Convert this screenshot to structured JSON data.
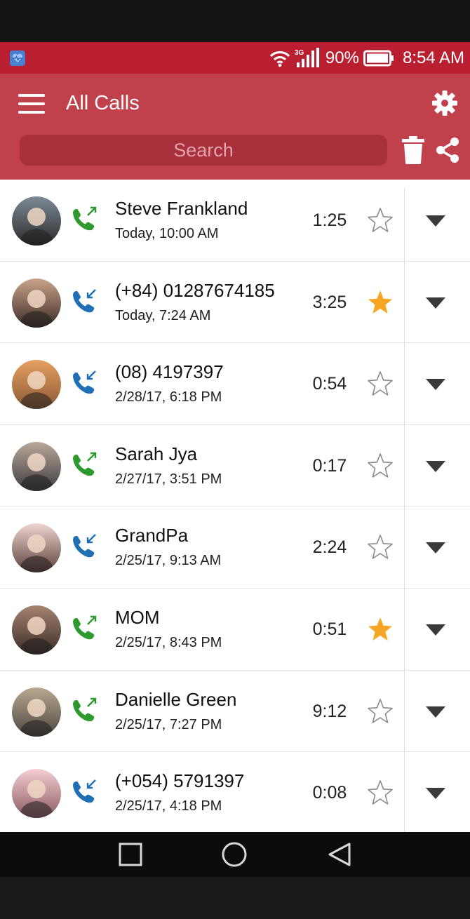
{
  "statusbar": {
    "network": "3G",
    "battery": "90%",
    "time": "8:54 AM"
  },
  "appbar": {
    "title": "All Calls",
    "search_placeholder": "Search"
  },
  "colors": {
    "statusbar": "#b91f30",
    "appbar": "#c0404b",
    "outgoing": "#2e9a2e",
    "incoming": "#1f6fb5",
    "favorite": "#f5a623"
  },
  "calls": [
    {
      "name": "Steve Frankland",
      "time": "Today, 10:00 AM",
      "duration": "1:25",
      "direction": "outgoing",
      "favorite": false
    },
    {
      "name": "(+84) 01287674185",
      "time": "Today, 7:24 AM",
      "duration": "3:25",
      "direction": "incoming",
      "favorite": true
    },
    {
      "name": "(08) 4197397",
      "time": "2/28/17, 6:18 PM",
      "duration": "0:54",
      "direction": "incoming",
      "favorite": false
    },
    {
      "name": "Sarah Jya",
      "time": "2/27/17, 3:51 PM",
      "duration": "0:17",
      "direction": "outgoing",
      "favorite": false
    },
    {
      "name": "GrandPa",
      "time": "2/25/17, 9:13 AM",
      "duration": "2:24",
      "direction": "incoming",
      "favorite": false
    },
    {
      "name": "MOM",
      "time": "2/25/17, 8:43 PM",
      "duration": "0:51",
      "direction": "outgoing",
      "favorite": true
    },
    {
      "name": "Danielle Green",
      "time": "2/25/17, 7:27 PM",
      "duration": "9:12",
      "direction": "outgoing",
      "favorite": false
    },
    {
      "name": "(+054) 5791397",
      "time": "2/25/17, 4:18 PM",
      "duration": "0:08",
      "direction": "incoming",
      "favorite": false
    }
  ]
}
